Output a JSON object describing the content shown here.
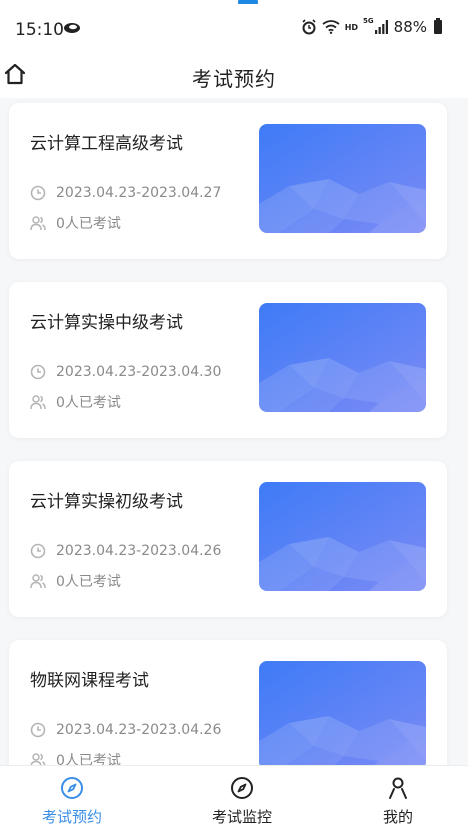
{
  "status_bar": {
    "time": "15:10",
    "hd": "HD",
    "network": "5G",
    "battery": "88%"
  },
  "header": {
    "title": "考试预约"
  },
  "exams": [
    {
      "name": "云计算工程高级考试",
      "date_range": "2023.04.23-2023.04.27",
      "takers": "0人已考试"
    },
    {
      "name": "云计算实操中级考试",
      "date_range": "2023.04.23-2023.04.30",
      "takers": "0人已考试"
    },
    {
      "name": "云计算实操初级考试",
      "date_range": "2023.04.23-2023.04.26",
      "takers": "0人已考试"
    },
    {
      "name": "物联网课程考试",
      "date_range": "2023.04.23-2023.04.26",
      "takers": "0人已考试"
    }
  ],
  "tabs": [
    {
      "label": "考试预约",
      "icon": "compass-icon",
      "active": true
    },
    {
      "label": "考试监控",
      "icon": "compass-icon",
      "active": false
    },
    {
      "label": "我的",
      "icon": "person-icon",
      "active": false
    }
  ],
  "colors": {
    "accent": "#3a8ee6",
    "thumb_gradient_start": "#3e7bf6",
    "thumb_gradient_end": "#7c8bf5"
  }
}
